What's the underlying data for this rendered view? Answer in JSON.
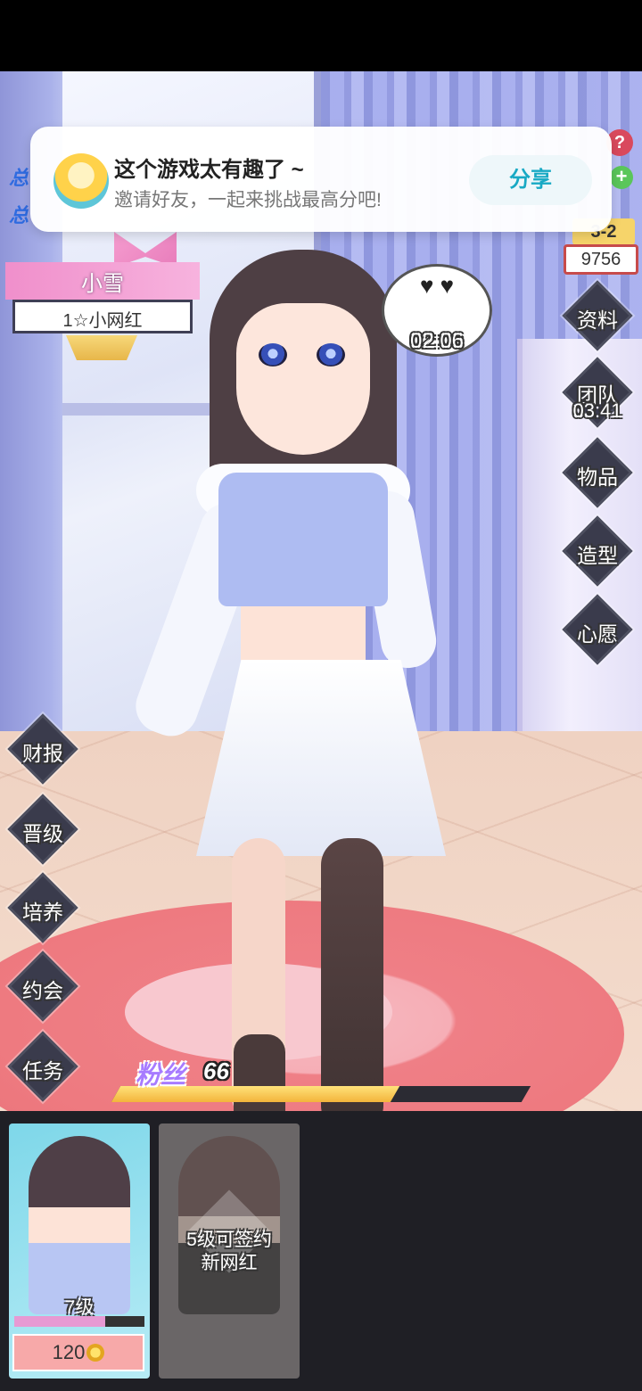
{
  "share_banner": {
    "title": "这个游戏太有趣了 ~",
    "subtitle": "邀请好友，一起来挑战最高分吧!",
    "share_label": "分享"
  },
  "partial_labels": [
    "总",
    "总"
  ],
  "character": {
    "name": "小雪",
    "rank": "1☆小网红"
  },
  "top_right": {
    "level": "3-2",
    "coins": "9756",
    "help_icon": "?",
    "plus_icon": "+"
  },
  "heart_bubble": {
    "icon": "finger-heart-icon",
    "glyphs": "♥ ♥",
    "timer": "02:06"
  },
  "right_menu": [
    {
      "label": "资料",
      "timer": ""
    },
    {
      "label": "团队",
      "timer": "03:41"
    },
    {
      "label": "物品",
      "timer": ""
    },
    {
      "label": "造型",
      "timer": ""
    },
    {
      "label": "心愿",
      "timer": ""
    }
  ],
  "left_menu": [
    {
      "label": "财报"
    },
    {
      "label": "晋级"
    },
    {
      "label": "培养"
    },
    {
      "label": "约会"
    },
    {
      "label": "任务"
    }
  ],
  "fans": {
    "label": "粉丝",
    "count": "66",
    "progress": 0.68
  },
  "cards": [
    {
      "level": "7级",
      "price": "120",
      "progress": 0.7
    },
    {
      "locked_text_1": "5级可签约",
      "locked_text_2": "新网红"
    }
  ],
  "colors": {
    "accent": "#18a9c4",
    "pink": "#f08fcb",
    "fans_fill": "#f3b43b"
  }
}
